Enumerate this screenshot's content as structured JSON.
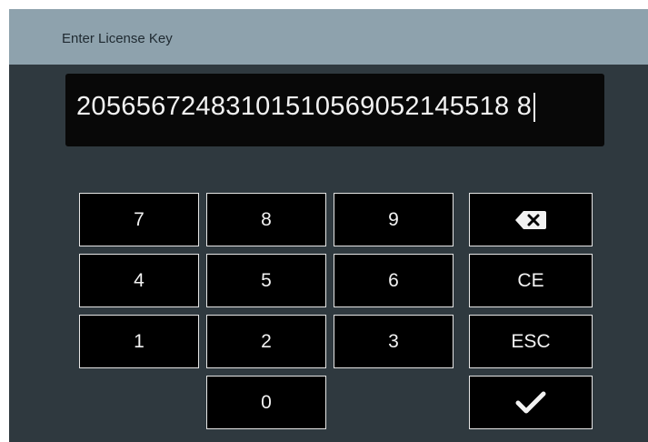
{
  "dialog": {
    "title": "Enter License Key",
    "input_value": "20565672483101510569052145518 8"
  },
  "keypad": {
    "k7": "7",
    "k8": "8",
    "k9": "9",
    "k4": "4",
    "k5": "5",
    "k6": "6",
    "k1": "1",
    "k2": "2",
    "k3": "3",
    "k0": "0",
    "clear_entry": "CE",
    "escape": "ESC",
    "backspace_icon": "backspace-icon",
    "confirm_icon": "checkmark-icon"
  },
  "colors": {
    "titlebar": "#8ea2ad",
    "background": "#2f393f",
    "display": "#080808",
    "key": "#000000",
    "key_border": "#e6e6e6",
    "text": "#f2f2f2"
  }
}
